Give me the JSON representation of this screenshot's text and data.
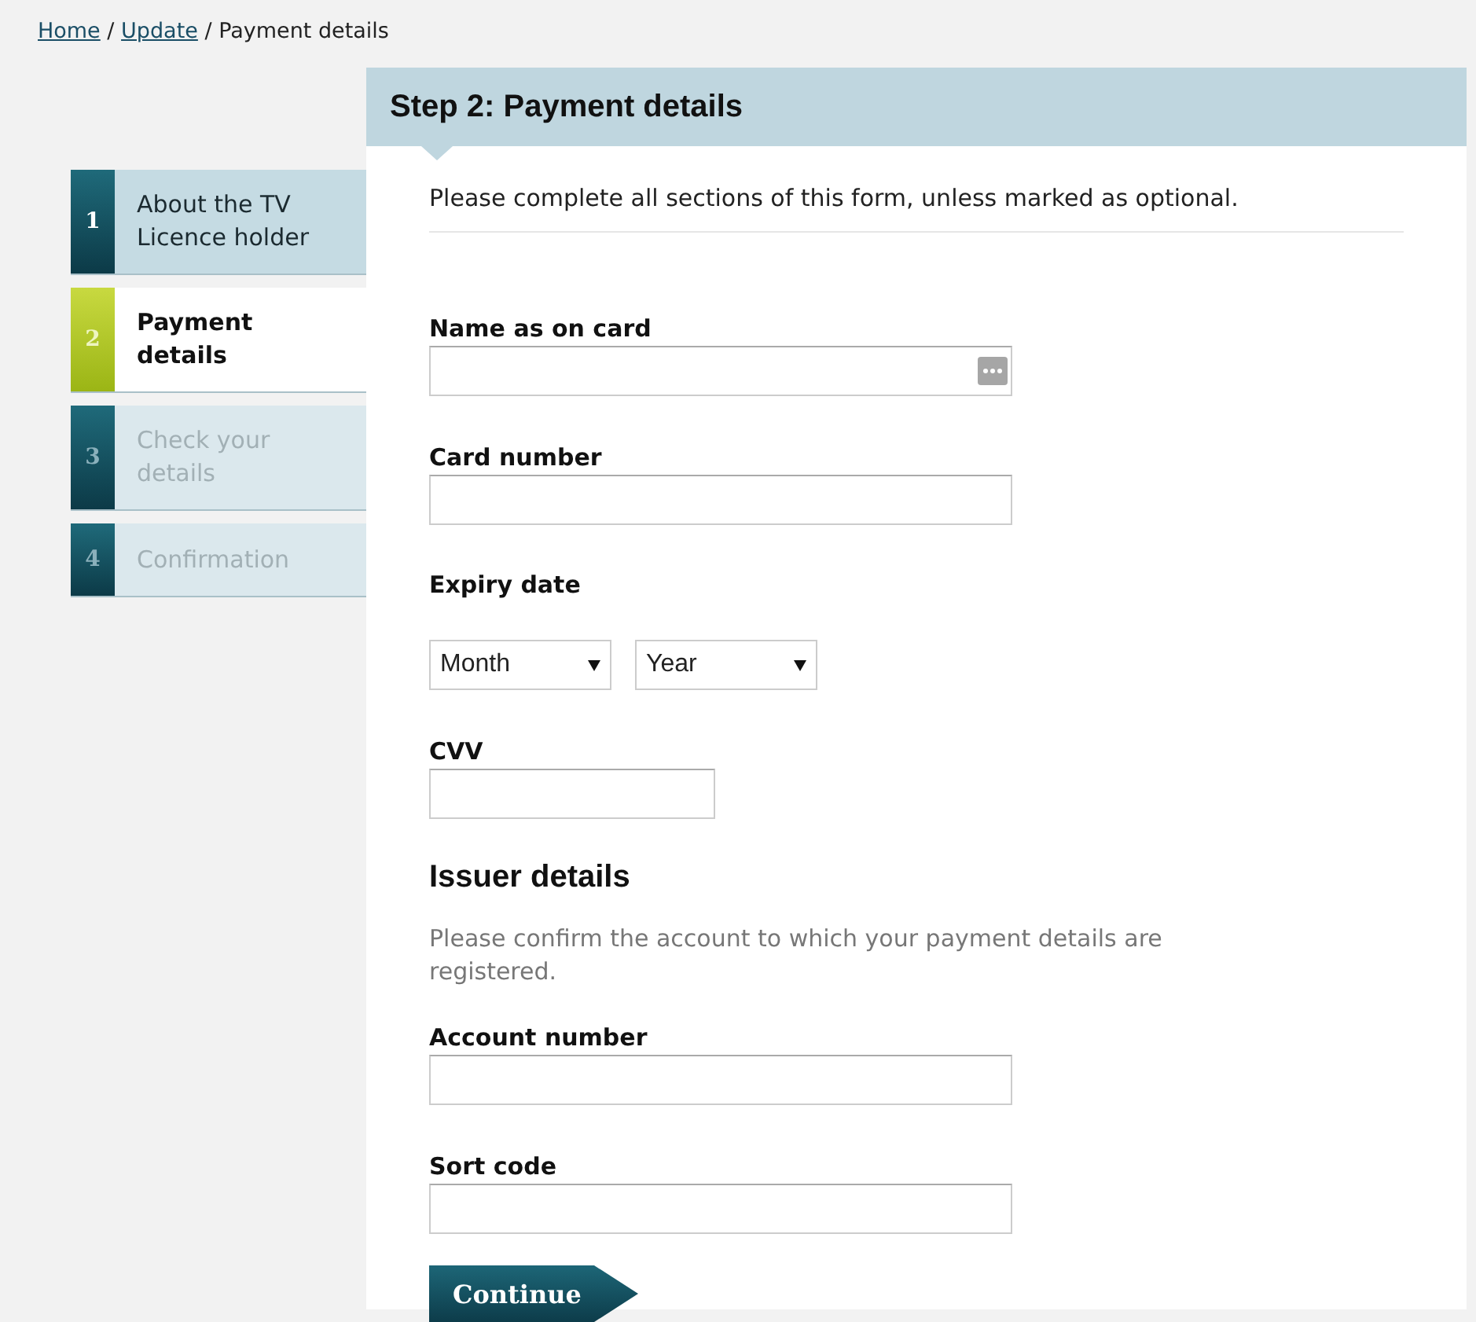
{
  "breadcrumb_separator": "/",
  "breadcrumb": [
    {
      "label": "Home",
      "link": true
    },
    {
      "label": "Update",
      "link": true
    },
    {
      "label": "Payment details",
      "link": false
    }
  ],
  "steps": [
    {
      "number": "1",
      "label": "About the TV Licence holder",
      "selected": false,
      "disabled": false
    },
    {
      "number": "2",
      "label": "Payment details",
      "selected": true,
      "disabled": false
    },
    {
      "number": "3",
      "label": "Check your details",
      "selected": false,
      "disabled": true
    },
    {
      "number": "4",
      "label": "Confirmation",
      "selected": false,
      "disabled": true
    }
  ],
  "panel": {
    "title": "Step 2: Payment details",
    "intro": "Please complete all sections of this form, unless marked as optional."
  },
  "sections": [
    {
      "kind": "fields",
      "items": [
        {
          "kind": "text",
          "label": "Name as on card",
          "autofill_icon": true
        },
        {
          "kind": "text",
          "label": "Card number"
        },
        {
          "kind": "selects",
          "label": "Expiry date",
          "options": [
            "Month",
            "Year"
          ]
        },
        {
          "kind": "short-text",
          "label": "CVV"
        }
      ]
    },
    {
      "kind": "heading",
      "text": "Issuer details",
      "note": "Please confirm the account to which your payment details are registered."
    },
    {
      "kind": "fields",
      "items": [
        {
          "kind": "text",
          "label": "Account number"
        },
        {
          "kind": "text",
          "label": "Sort code"
        }
      ]
    }
  ],
  "button": "Continue"
}
